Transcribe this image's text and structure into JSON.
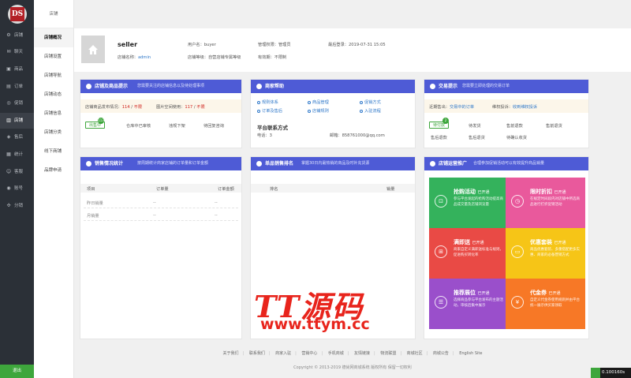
{
  "app": {
    "logo": "DS"
  },
  "sidebar": {
    "items": [
      {
        "label": "店铺",
        "icon": "gear-icon",
        "glyph": "⚙"
      },
      {
        "label": "聊天",
        "icon": "chat-icon",
        "glyph": "✉"
      },
      {
        "label": "商品",
        "icon": "box-icon",
        "glyph": "▣"
      },
      {
        "label": "订单",
        "icon": "order-icon",
        "glyph": "▤"
      },
      {
        "label": "促销",
        "icon": "promo-icon",
        "glyph": "◎"
      },
      {
        "label": "店铺",
        "icon": "store-icon",
        "glyph": "▥"
      },
      {
        "label": "售后",
        "icon": "service-icon",
        "glyph": "◈"
      },
      {
        "label": "统计",
        "icon": "chart-icon",
        "glyph": "▦"
      },
      {
        "label": "客服",
        "icon": "support-icon",
        "glyph": "☺"
      },
      {
        "label": "账号",
        "icon": "user-icon",
        "glyph": "◉"
      },
      {
        "label": "分销",
        "icon": "share-icon",
        "glyph": "✣"
      }
    ],
    "logout": "退出"
  },
  "subnav": {
    "title": "店铺",
    "items": [
      "店铺概况",
      "店铺设置",
      "店铺导航",
      "店铺动态",
      "店铺信息",
      "店铺分类",
      "线下商铺",
      "品牌申请"
    ]
  },
  "profile": {
    "name": "seller",
    "store_name_label": "店铺名称：",
    "store_name": "admin",
    "username_label": "用户名：",
    "username": "buyer",
    "store_level_label": "店铺等级：",
    "store_level": "自营店铺专属等级",
    "admin_label": "管理权限：",
    "admin": "管理员",
    "expiry_label": "有效期：",
    "expiry": "不限制",
    "last_login_label": "最后登录：",
    "last_login": "2019-07-31 15:05"
  },
  "panels": {
    "tips": {
      "title": "店铺及商品提示",
      "desc": "您需要关注的店铺信息以及待处理事项",
      "goods_count_label": "店铺商品发布情况：",
      "goods_count": "114",
      "goods_limit": "不限",
      "album_label": "图片空间使用：",
      "album_count": "117",
      "album_limit": "不限",
      "pills": [
        "出售中",
        "仓库中已审核",
        "违规下架",
        "待回复咨询"
      ],
      "badge": "113"
    },
    "contact": {
      "title": "商家帮助",
      "links": [
        "规则体系",
        "商品管理",
        "促销方式",
        "订单及售后",
        "店铺规则",
        "入驻流程"
      ],
      "platform_title": "平台联系方式",
      "phone_label": "电话：",
      "phone": "3",
      "email_label": "邮箱：",
      "email": "858761000@qq.com"
    },
    "trade": {
      "title": "交易提示",
      "desc": "您需要立即处理的交易订单",
      "recent_label": "近期售出：",
      "recent": "交易中的订单",
      "rights_label": "维权投诉：",
      "rights": "收到维权投诉",
      "pills": [
        "待付款",
        "待发货",
        "售前退款",
        "售前退货",
        "售后退款",
        "售后退货",
        "待确认收货"
      ],
      "badge": "2"
    },
    "sales": {
      "title": "销售情况统计",
      "desc": "按周期统计商家店铺的订单量和订单金额",
      "cols": [
        "项目",
        "订单量",
        "订单金额"
      ],
      "rows": [
        {
          "name": "昨日销量",
          "count": "--",
          "amount": "--"
        },
        {
          "name": "月销量",
          "count": "--",
          "amount": "--"
        }
      ]
    },
    "ranking": {
      "title": "单品销售排名",
      "desc": "掌握30日内最热销的商品及时补充货源",
      "cols": [
        "排名",
        "销量"
      ]
    },
    "promo": {
      "title": "店铺运营推广",
      "desc": "合理参加促销活动可以有效提升商品销量",
      "tiles": [
        {
          "title": "抢购活动",
          "tag": "已开通",
          "icon": "bag-icon",
          "glyph": "⊡",
          "color": "#34b25c",
          "desc": "参与平台发起的抢购活动提高商品成交量及店铺浏览量"
        },
        {
          "title": "限时折扣",
          "tag": "已开通",
          "icon": "clock-icon",
          "glyph": "◷",
          "color": "#e9599c",
          "desc": "在规定时间段内对店铺中所选商品进行打折促销活动"
        },
        {
          "title": "满即送",
          "tag": "已开通",
          "icon": "gift-icon",
          "glyph": "⊞",
          "color": "#e94a45",
          "desc": "商家自定义满即送标准与规则，促进购买转化率"
        },
        {
          "title": "优惠套装",
          "tag": "已开通",
          "icon": "ticket-icon",
          "glyph": "▭",
          "color": "#f6c517",
          "desc": "商品优惠套装、多重搭配更多实惠、商家的必备营销方式"
        },
        {
          "title": "推荐展位",
          "tag": "已开通",
          "icon": "list-icon",
          "glyph": "☰",
          "color": "#9a4fcb",
          "desc": "选择商品参与平台发布的主题活动，审核后集中展示"
        },
        {
          "title": "代金券",
          "tag": "已开通",
          "icon": "yen-icon",
          "glyph": "¥",
          "color": "#f77826",
          "desc": "自定义代金券使用规则并由平台统一展示供买家领取"
        }
      ]
    }
  },
  "footer": {
    "links": [
      "关于我们",
      "联系我们",
      "商家入驻",
      "营销中心",
      "手机商城",
      "友情链接",
      "物流联盟",
      "商城社区",
      "商城公告",
      "English Site"
    ],
    "copyright": "Copyright © 2013-2019 德尚网商城系统 版权所有 保留一切权利"
  },
  "watermark": {
    "line1": "TT源码",
    "line2": "www.ttym.cc"
  },
  "timer": "0.100160s"
}
